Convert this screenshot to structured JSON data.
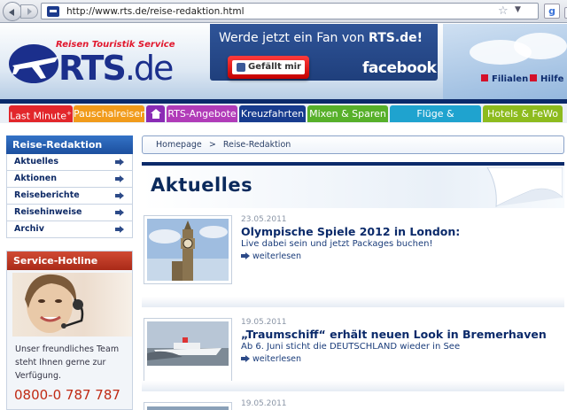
{
  "browser": {
    "url": "http://www.rts.de/reise-redaktion.html"
  },
  "header": {
    "tagline": "Reisen Touristik Service",
    "logo_main": "RTS",
    "logo_suffix": ".de",
    "fb_text_prefix": "Werde jetzt ein Fan von ",
    "fb_text_brand": "RTS.de!",
    "fb_like": "Gefällt mir",
    "fb_logo": "facebook",
    "link_filialen": "Filialen",
    "link_hilfe": "Hilfe"
  },
  "nav": {
    "tabs": [
      {
        "label": "Last Minute",
        "color": "#e2262b",
        "sup": "+"
      },
      {
        "label": "Pauschalreisen",
        "color": "#f19b1b"
      },
      {
        "label": "home-icon",
        "color": "#8a2bb5"
      },
      {
        "label": "RTS-Angebote",
        "color": "#b13bb8"
      },
      {
        "label": "Kreuzfahrten",
        "color": "#173b8e"
      },
      {
        "label": "Mixen & Sparen",
        "color": "#57b02a"
      },
      {
        "label": "Flüge & Mietwagen",
        "color": "#1fa3cf"
      },
      {
        "label": "Hotels & FeWo",
        "color": "#8dbb1e"
      }
    ]
  },
  "sidebar": {
    "title": "Reise-Redaktion",
    "items": [
      {
        "label": "Aktuelles"
      },
      {
        "label": "Aktionen"
      },
      {
        "label": "Reiseberichte"
      },
      {
        "label": "Reisehinweise"
      },
      {
        "label": "Archiv"
      }
    ]
  },
  "hotline": {
    "title": "Service-Hotline",
    "text": "Unser freundliches Team steht Ihnen gerne zur Verfügung.",
    "phone": "0800-0 787 787"
  },
  "breadcrumb": {
    "home": "Homepage",
    "sep": ">",
    "current": "Reise-Redaktion"
  },
  "main": {
    "section_title": "Aktuelles",
    "articles": [
      {
        "date": "23.05.2011",
        "title": "Olympische Spiele 2012 in London:",
        "subtitle": "Live dabei sein und jetzt Packages buchen!",
        "more": "weiterlesen"
      },
      {
        "date": "19.05.2011",
        "title": "„Traumschiff“ erhält neuen Look in Bremerhaven",
        "subtitle": "Ab 6. Juni sticht die DEUTSCHLAND wieder in See",
        "more": "weiterlesen"
      },
      {
        "date": "19.05.2011"
      }
    ]
  }
}
